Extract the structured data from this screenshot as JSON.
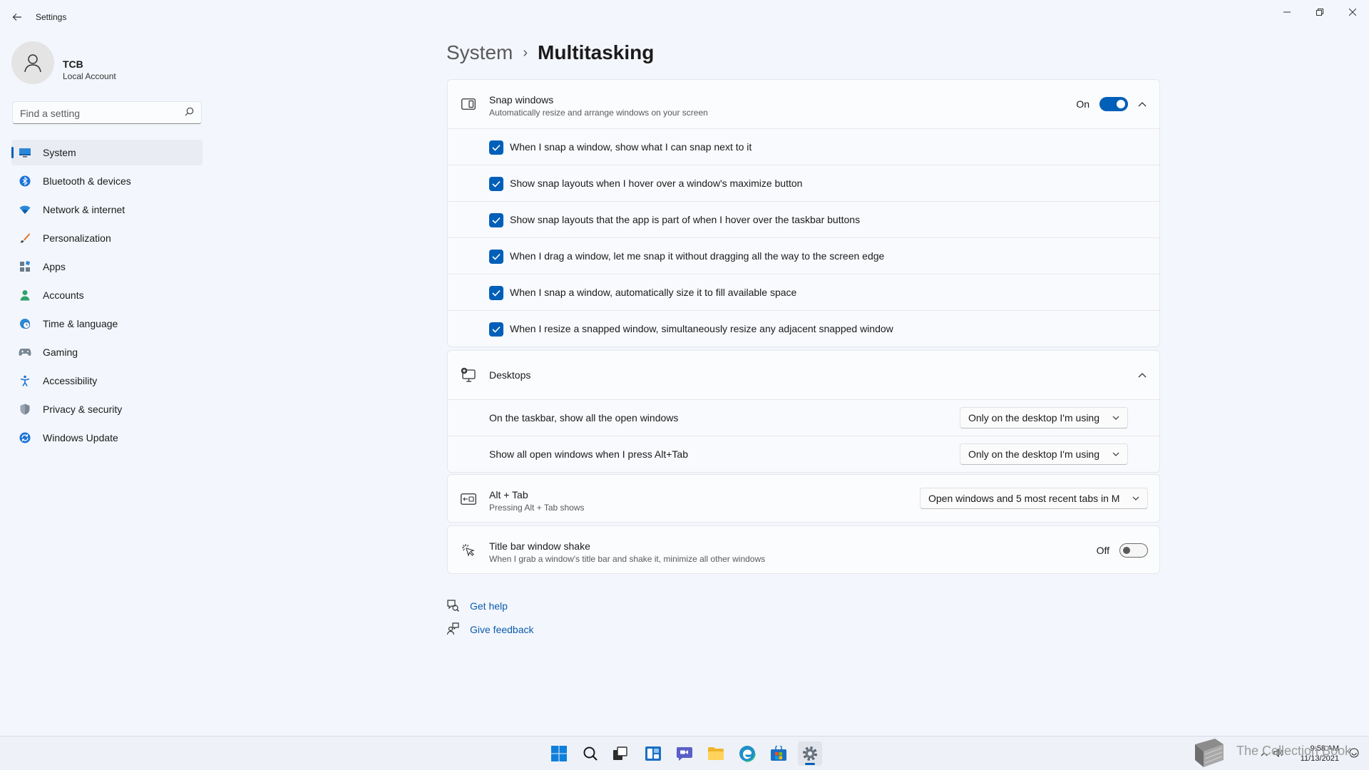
{
  "window": {
    "title": "Settings"
  },
  "profile": {
    "name": "TCB",
    "subtitle": "Local Account"
  },
  "search": {
    "placeholder": "Find a setting"
  },
  "nav": [
    {
      "label": "System",
      "icon": "monitor-icon",
      "active": true
    },
    {
      "label": "Bluetooth & devices",
      "icon": "bluetooth-icon"
    },
    {
      "label": "Network & internet",
      "icon": "wifi-icon"
    },
    {
      "label": "Personalization",
      "icon": "brush-icon"
    },
    {
      "label": "Apps",
      "icon": "apps-icon"
    },
    {
      "label": "Accounts",
      "icon": "person-icon"
    },
    {
      "label": "Time & language",
      "icon": "globe-clock-icon"
    },
    {
      "label": "Gaming",
      "icon": "gamepad-icon"
    },
    {
      "label": "Accessibility",
      "icon": "accessibility-icon"
    },
    {
      "label": "Privacy & security",
      "icon": "shield-icon"
    },
    {
      "label": "Windows Update",
      "icon": "update-icon"
    }
  ],
  "breadcrumb": {
    "parent": "System",
    "separator": "›",
    "current": "Multitasking"
  },
  "snap": {
    "title": "Snap windows",
    "description": "Automatically resize and arrange windows on your screen",
    "toggle_label": "On",
    "options": [
      "When I snap a window, show what I can snap next to it",
      "Show snap layouts when I hover over a window's maximize button",
      "Show snap layouts that the app is part of when I hover over the taskbar buttons",
      "When I drag a window, let me snap it without dragging all the way to the screen edge",
      "When I snap a window, automatically size it to fill available space",
      "When I resize a snapped window, simultaneously resize any adjacent snapped window"
    ]
  },
  "desktops": {
    "title": "Desktops",
    "rows": [
      {
        "label": "On the taskbar, show all the open windows",
        "value": "Only on the desktop I'm using"
      },
      {
        "label": "Show all open windows when I press Alt+Tab",
        "value": "Only on the desktop I'm using"
      }
    ]
  },
  "alttab": {
    "title": "Alt + Tab",
    "description": "Pressing Alt + Tab shows",
    "value": "Open windows and 5 most recent tabs in M"
  },
  "shake": {
    "title": "Title bar window shake",
    "description": "When I grab a window's title bar and shake it, minimize all other windows",
    "toggle_label": "Off"
  },
  "links": {
    "help": "Get help",
    "feedback": "Give feedback"
  },
  "taskbar": {
    "time": "9:58 AM",
    "date": "11/13/2021",
    "watermark": "The Collection Book"
  },
  "colors": {
    "accent": "#005fb8",
    "link": "#0b5cad",
    "background": "#f3f6fc"
  }
}
